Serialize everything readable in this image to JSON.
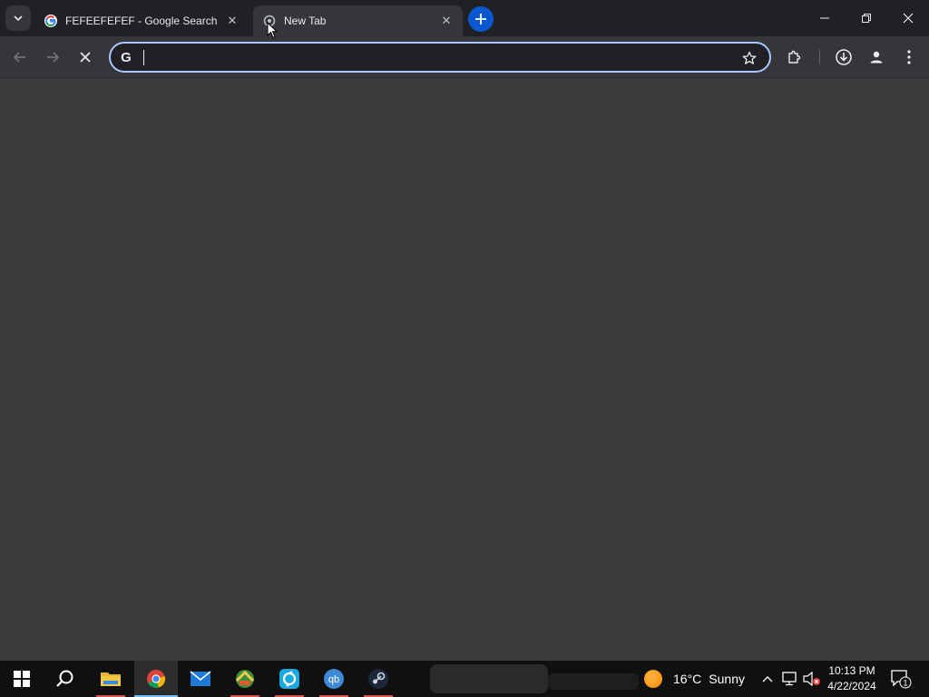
{
  "browser": {
    "tabs": [
      {
        "title": "FEFEEFEFEF - Google Search",
        "favicon": "google-g-icon",
        "active": false
      },
      {
        "title": "New Tab",
        "favicon": "loading-globe-icon",
        "active": true
      }
    ],
    "new_tab_label": "+",
    "window_controls": [
      "minimize-icon",
      "restore-icon",
      "close-icon"
    ]
  },
  "toolbar": {
    "back_icon": "back-arrow-icon",
    "forward_icon": "forward-arrow-icon",
    "stop_icon": "stop-loading-icon",
    "omnibox": {
      "value": "",
      "search_engine_icon": "G"
    },
    "right_icons": [
      "bookmark-star-icon",
      "extensions-icon",
      "downloads-icon",
      "profile-icon",
      "menu-icon"
    ]
  },
  "taskbar": {
    "apps": [
      "start-button",
      "search-icon",
      "file-explorer-icon",
      "chrome-icon",
      "mail-icon",
      "app-icon",
      "app-icon",
      "qbittorrent-icon",
      "steam-icon"
    ],
    "weather": {
      "temperature": "16°C",
      "condition": "Sunny"
    },
    "clock": {
      "time": "10:13 PM",
      "date": "4/22/2024"
    },
    "notification_count": "1"
  },
  "colors": {
    "tabstrip_bg": "#202124",
    "toolbar_bg": "#35363a",
    "content_bg": "#3c3c3c",
    "accent_blue": "#0b57d0",
    "omnibox_focus": "#a8c7fa",
    "taskbar_bg": "#101010"
  }
}
